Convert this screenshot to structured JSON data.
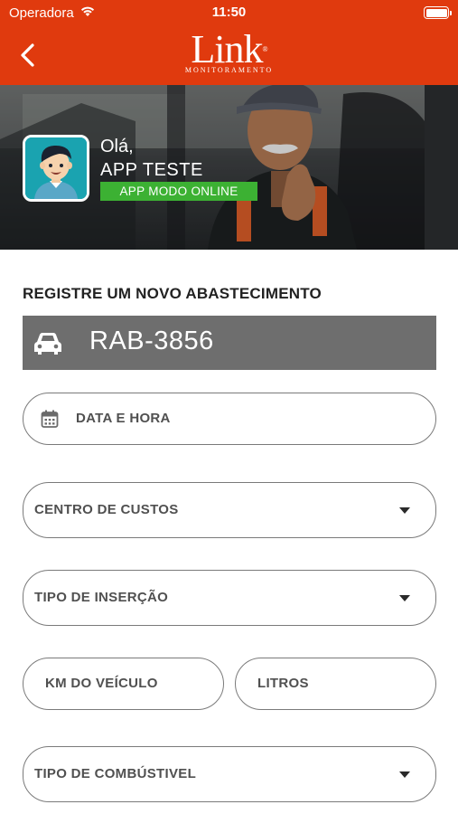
{
  "status_bar": {
    "carrier": "Operadora",
    "time": "11:50"
  },
  "nav": {
    "back_icon": "chevron-left-icon",
    "logo_text": "Link",
    "logo_reg": "®",
    "logo_subtext": "MONITORAMENTO"
  },
  "profile": {
    "greeting": "Olá,",
    "user_name": "APP TESTE",
    "mode_badge": "APP MODO ONLINE"
  },
  "form": {
    "title": "REGISTRE UM NOVO ABASTECIMENTO",
    "vehicle_plate": "RAB-3856",
    "date_time_placeholder": "DATA E HORA",
    "cost_center_label": "CENTRO DE CUSTOS",
    "insertion_type_label": "TIPO DE INSERÇÃO",
    "km_label": "KM DO VEÍCULO",
    "liters_label": "LITROS",
    "fuel_type_label": "TIPO DE COMBÚSTIVEL"
  },
  "colors": {
    "brand_red": "#e03a0e",
    "online_green": "#3cb133",
    "plate_bar_gray": "#6e6e6e",
    "avatar_teal": "#1aa3b0"
  }
}
